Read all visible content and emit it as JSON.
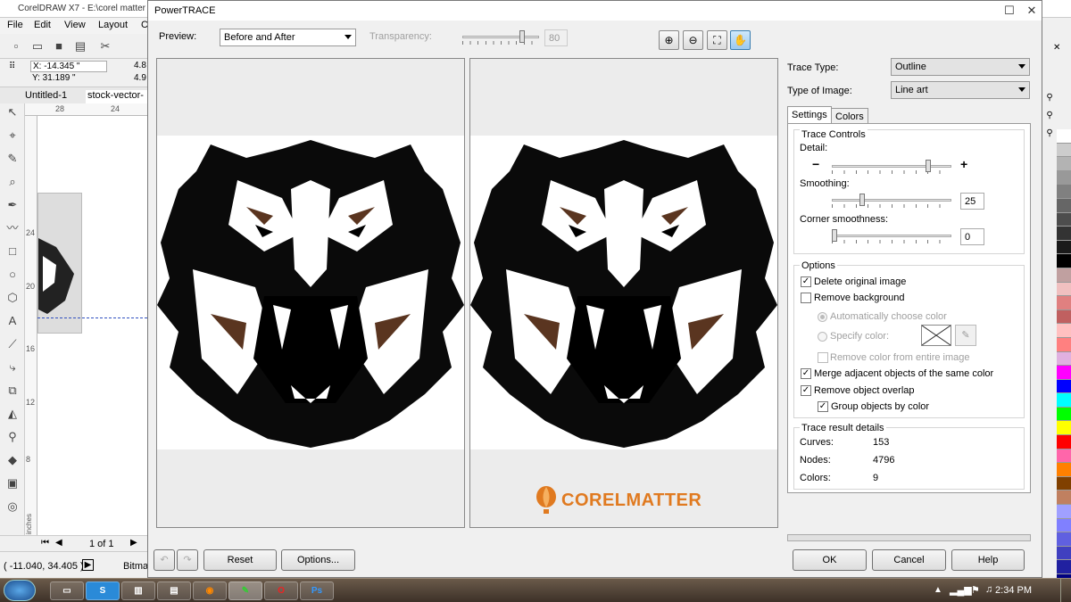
{
  "app": {
    "title": "CorelDRAW X7 - E:\\corel matter",
    "menu": [
      "File",
      "Edit",
      "View",
      "Layout",
      "C"
    ],
    "coords": {
      "x": "X: -14.345 \"",
      "y": "Y: 31.189 \"",
      "w": "4.8",
      "h": "4.9"
    },
    "doc_tabs": [
      "Untitled-1",
      "stock-vector-a"
    ],
    "ruler_h": [
      "28",
      "24"
    ],
    "ruler_v": [
      "24",
      "20",
      "16",
      "12",
      "8"
    ],
    "ruler_unit": "inches",
    "page_indicator": "1 of 1",
    "status_coords": "( -11.040, 34.405 )",
    "status_right": "Bitma",
    "palette": [
      "#ffffff",
      "#cccccc",
      "#b3b3b3",
      "#999999",
      "#808080",
      "#666666",
      "#4d4d4d",
      "#333333",
      "#1a1a1a",
      "#000000",
      "#c0a0a0",
      "#f0c0c0",
      "#e08080",
      "#c06060",
      "#ffc0c0",
      "#ff8080",
      "#e0b0e0",
      "#ff00ff",
      "#0000ff",
      "#00ffff",
      "#00ff00",
      "#ffff00",
      "#ff0000",
      "#ff66aa",
      "#ff8000",
      "#804000",
      "#c08060",
      "#a0a0ff",
      "#8080ff",
      "#6060e0",
      "#4040c0",
      "#2020a0",
      "#000080"
    ]
  },
  "dialog": {
    "title": "PowerTRACE",
    "preview_label": "Preview:",
    "preview_value": "Before and After",
    "transparency_label": "Transparency:",
    "transparency_value": "80",
    "trace_type_label": "Trace Type:",
    "trace_type_value": "Outline",
    "image_type_label": "Type of Image:",
    "image_type_value": "Line art",
    "tabs": {
      "settings": "Settings",
      "colors": "Colors"
    },
    "trace_controls": {
      "title": "Trace Controls",
      "detail_label": "Detail:",
      "detail_level": 0.82,
      "smoothing_label": "Smoothing:",
      "smoothing_value": "25",
      "corner_label": "Corner smoothness:",
      "corner_value": "0"
    },
    "options": {
      "title": "Options",
      "delete_original": "Delete original image",
      "remove_background": "Remove background",
      "auto_color": "Automatically choose color",
      "specify_color": "Specify color:",
      "remove_entire": "Remove color from entire image",
      "merge_adjacent": "Merge adjacent objects of the same color",
      "remove_overlap": "Remove object overlap",
      "group_by_color": "Group objects by color"
    },
    "results": {
      "title": "Trace result details",
      "curves_label": "Curves:",
      "curves_value": "153",
      "nodes_label": "Nodes:",
      "nodes_value": "4796",
      "colors_label": "Colors:",
      "colors_value": "9"
    },
    "watermark": "CORELMATTER",
    "buttons": {
      "reset": "Reset",
      "options": "Options...",
      "ok": "OK",
      "cancel": "Cancel",
      "help": "Help"
    }
  },
  "taskbar": {
    "clock": "2:34 PM"
  }
}
